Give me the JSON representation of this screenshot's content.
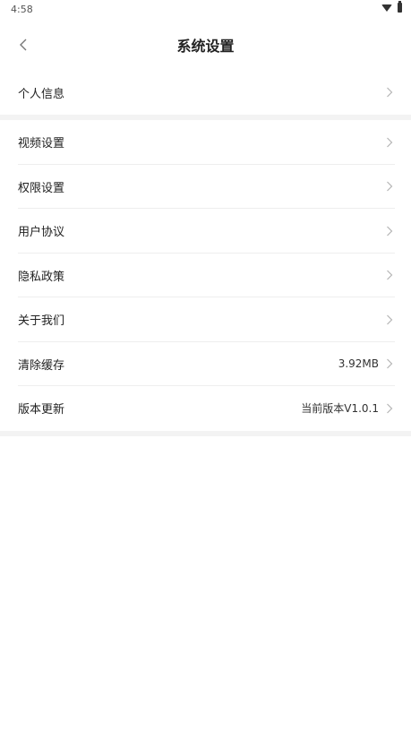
{
  "status_bar": {
    "time": "4:58"
  },
  "nav": {
    "title": "系统设置",
    "back_icon": "chevron-left-icon"
  },
  "group1": {
    "items": [
      {
        "label": "个人信息",
        "value": ""
      }
    ]
  },
  "group2": {
    "items": [
      {
        "label": "视频设置",
        "value": ""
      },
      {
        "label": "权限设置",
        "value": ""
      },
      {
        "label": "用户协议",
        "value": ""
      },
      {
        "label": "隐私政策",
        "value": ""
      },
      {
        "label": "关于我们",
        "value": ""
      },
      {
        "label": "清除缓存",
        "value": "3.92MB"
      },
      {
        "label": "版本更新",
        "value": "当前版本V1.0.1"
      }
    ]
  },
  "colors": {
    "separator": "#f3f3f3",
    "divider": "#eeeeee",
    "chevron": "#b5b5b5"
  }
}
